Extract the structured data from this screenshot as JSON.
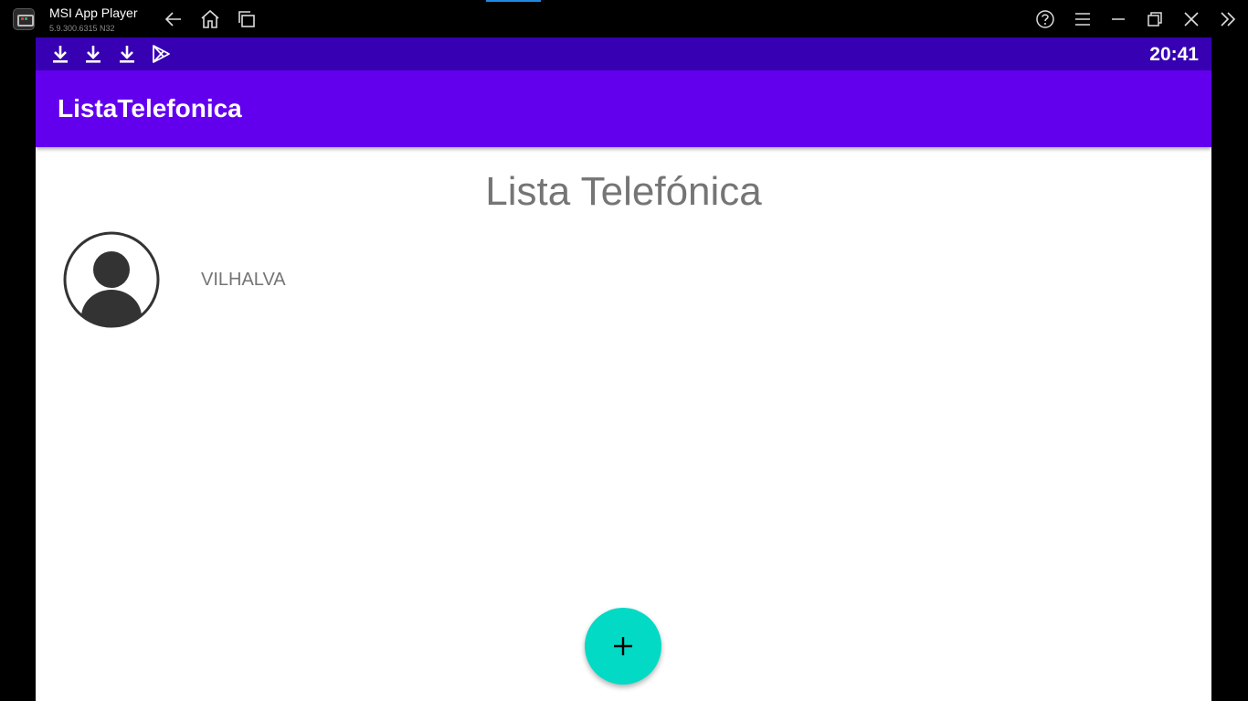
{
  "window": {
    "app_name": "MSI App Player",
    "app_version": "5.9.300.6315  N32",
    "accent_color": "#1e88e5"
  },
  "titlebar_icons": [
    "back-icon",
    "home-icon",
    "recent-apps-icon",
    "help-icon",
    "menu-icon",
    "minimize-icon",
    "restore-icon",
    "close-icon",
    "expand-sidebar-icon"
  ],
  "statusbar": {
    "time": "20:41",
    "notification_icons": [
      "download-icon",
      "download-icon",
      "download-icon",
      "play-store-icon"
    ],
    "color": "#3700b3"
  },
  "appbar": {
    "title": "ListaTelefonica",
    "color": "#6200ee"
  },
  "main": {
    "heading": "Lista Telefónica",
    "contacts": [
      {
        "name": "VILHALVA",
        "icon": "account-circle-icon"
      }
    ]
  },
  "fab": {
    "icon": "plus-icon",
    "color": "#03dac5"
  }
}
